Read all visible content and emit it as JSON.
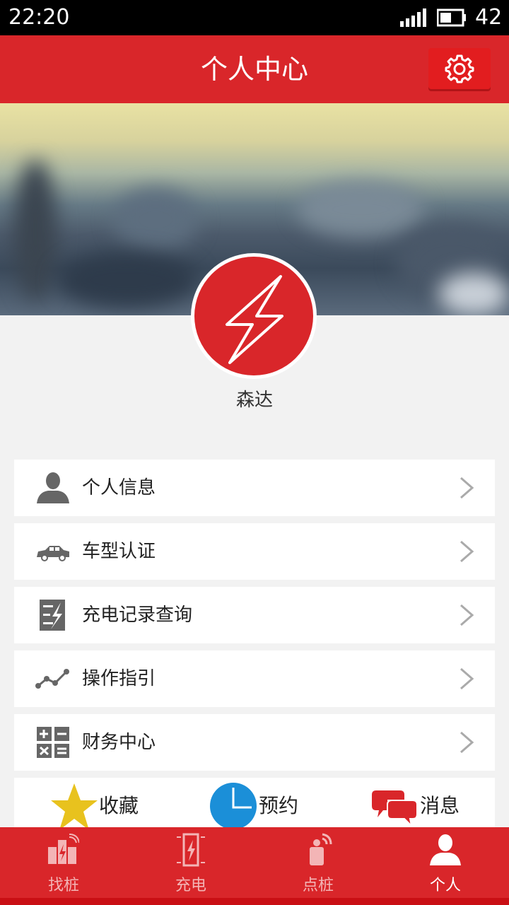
{
  "status_bar": {
    "time": "22:20",
    "battery_level": "42",
    "signal_icon": "signal-bars-icon",
    "battery_icon": "battery-icon"
  },
  "header": {
    "title": "个人中心",
    "settings_icon": "gear-icon"
  },
  "profile": {
    "avatar_icon": "lightning-bolt-icon",
    "name": "森达"
  },
  "menu": {
    "items": [
      {
        "label": "个人信息",
        "icon": "person-icon"
      },
      {
        "label": "车型认证",
        "icon": "car-icon"
      },
      {
        "label": "充电记录查询",
        "icon": "charging-record-icon"
      },
      {
        "label": "操作指引",
        "icon": "line-graph-icon"
      },
      {
        "label": "财务中心",
        "icon": "calculator-icon"
      }
    ]
  },
  "quick_actions": [
    {
      "label": "收藏",
      "icon": "star-icon"
    },
    {
      "label": "预约",
      "icon": "clock-icon"
    },
    {
      "label": "消息",
      "icon": "chat-bubbles-icon"
    }
  ],
  "tabs": [
    {
      "label": "找桩",
      "icon": "find-charger-icon",
      "active": false
    },
    {
      "label": "充电",
      "icon": "charge-icon",
      "active": false
    },
    {
      "label": "点桩",
      "icon": "point-charger-icon",
      "active": false
    },
    {
      "label": "个人",
      "icon": "person-icon",
      "active": true
    }
  ],
  "colors": {
    "brand_red": "#d9262a",
    "star_yellow": "#e8c21e",
    "clock_blue": "#1b8fd8",
    "chat_red": "#d9262a",
    "inactive_tab": "#f3b5b6",
    "active_tab": "#ffffff"
  }
}
